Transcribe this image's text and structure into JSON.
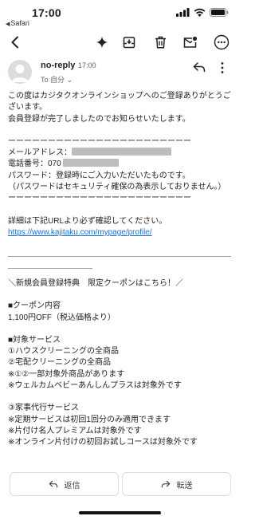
{
  "status_bar": {
    "time": "17:00",
    "back_app": "Safari"
  },
  "toolbar": {
    "icons": [
      "back-arrow-icon",
      "sparkle-icon",
      "archive-icon",
      "trash-icon",
      "mark-unread-icon",
      "more-icon"
    ]
  },
  "email": {
    "sender": "no-reply",
    "time": "17:00",
    "to": "To 自分 ⌄",
    "body_intro_1": "この度はカジタクオンラインショップへのご登録ありがとうございます。",
    "body_intro_2": "会員登録が完了しましたのでお知らせいたします。",
    "divider": "ーーーーーーーーーーーーーーーーーーーーーーー",
    "email_label": "メールアドレス：",
    "phone_label": "電話番号：",
    "phone_prefix": "070",
    "password_line": "パスワード：登録時にご入力いただいたものです。",
    "password_note": "（パスワードはセキュリティ確保の為表示しておりません。）",
    "detail_text": "詳細は下記URLより必ず確認してください。",
    "detail_url": "https://www.kajitaku.com/mypage/profile/",
    "campaign_heading": "＼新規会員登録特典　限定クーポンはこちら！／",
    "coupon_heading": "■クーポン内容",
    "coupon_value": "1,100円OFF（税込価格より）",
    "services_heading": "■対象サービス",
    "service_1": "①ハウスクリーニングの全商品",
    "service_2": "②宅配クリーニングの全商品",
    "service_note_1": "※①②一部対象外商品があります",
    "service_note_2": "※ウェルカムベビーあんしんプラスは対象外です",
    "service_3": "③家事代行サービス",
    "service_note_3": "※定期サービスは初回1回分のみ適用できます",
    "service_note_4": "※片付け名人プレミアムは対象外です",
    "service_note_5": "※オンライン片付けの初回お試しコースは対象外です"
  },
  "actions": {
    "reply": "返信",
    "forward": "転送"
  },
  "colors": {
    "link": "#1a73e8",
    "redaction": "#bdbdbd"
  }
}
